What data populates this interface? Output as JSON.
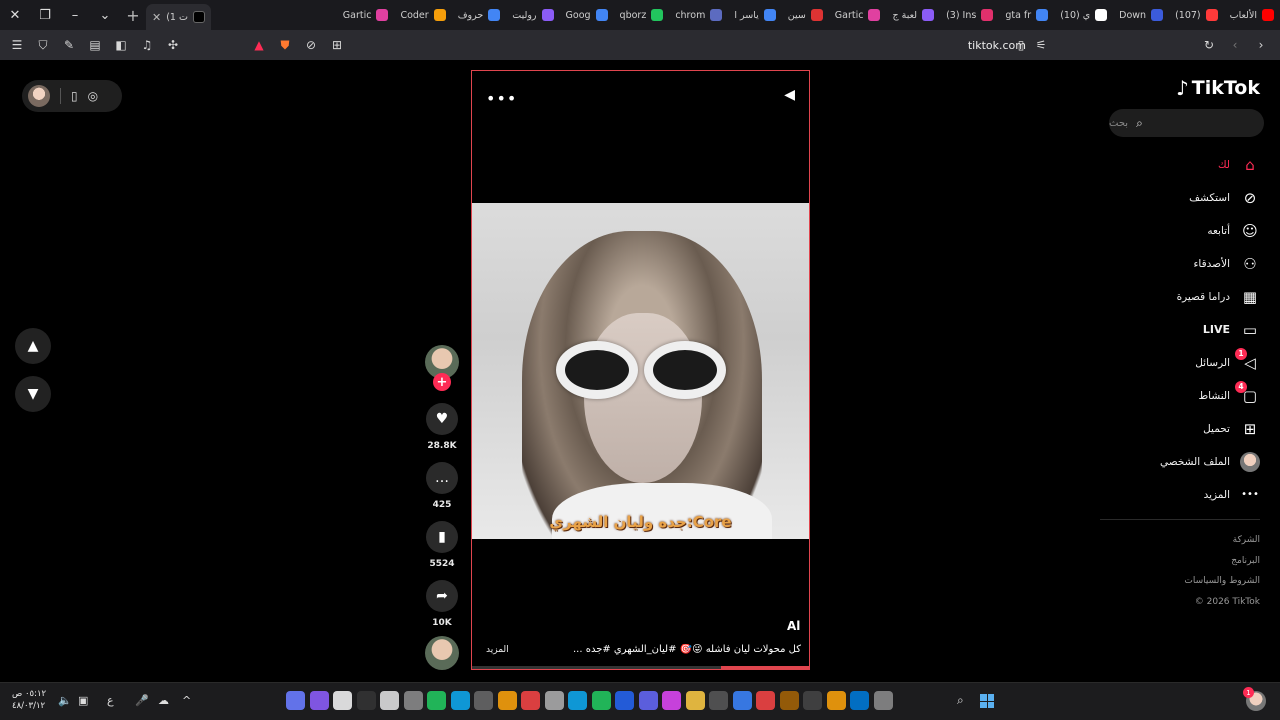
{
  "browser": {
    "tabs": [
      {
        "label": "الألعاب",
        "color": "#ff0000"
      },
      {
        "label": "(107)",
        "color": "#ff3a3a"
      },
      {
        "label": "Down",
        "color": "#3b5bdb"
      },
      {
        "label": "(10) ي",
        "color": "#ffffff"
      },
      {
        "label": "gta fr",
        "color": "#4285f4"
      },
      {
        "label": "(3) Ins",
        "color": "#e1306c"
      },
      {
        "label": "لعبة ج",
        "color": "#8b5cf6"
      },
      {
        "label": "Gartic",
        "color": "#e040a0"
      },
      {
        "label": "سين",
        "color": "#d33"
      },
      {
        "label": "ياسر ا",
        "color": "#4285f4"
      },
      {
        "label": "chrom",
        "color": "#5c6bc0"
      },
      {
        "label": "qborz",
        "color": "#22c55e"
      },
      {
        "label": "Goog",
        "color": "#4285f4"
      },
      {
        "label": "روليت",
        "color": "#8b5cf6"
      },
      {
        "label": "حروف",
        "color": "#4285f4"
      },
      {
        "label": "Coder",
        "color": "#f59e0b"
      },
      {
        "label": "Gartic",
        "color": "#e040a0"
      }
    ],
    "active_tab": {
      "label": "(1 ت",
      "color": "#000000"
    },
    "address": "tiktok.com"
  },
  "page": {
    "nav_up": "▲",
    "nav_down": "▼"
  },
  "video": {
    "overlay_caption": "جده وليان الشهري:Core",
    "author": "Al",
    "description": "كل محولات ليان فاشله 😜🎯 #ليان_الشهري #جده ...",
    "more_label": "المزيد",
    "progress": 0.26
  },
  "actions": {
    "likes": "28.8K",
    "comments": "425",
    "saves": "5524",
    "shares": "10K"
  },
  "sidebar": {
    "logo": "TikTok",
    "search_placeholder": "بحث",
    "items": [
      {
        "label": "لك",
        "icon": "home-icon",
        "active": true
      },
      {
        "label": "استكشف",
        "icon": "compass-icon"
      },
      {
        "label": "أتابعه",
        "icon": "following-icon"
      },
      {
        "label": "الأصدقاء",
        "icon": "friends-icon"
      },
      {
        "label": "دراما قصيرة",
        "icon": "film-icon"
      },
      {
        "label": "LIVE",
        "icon": "live-icon"
      },
      {
        "label": "الرسائل",
        "icon": "messages-icon",
        "badge": "1"
      },
      {
        "label": "النشاط",
        "icon": "activity-icon",
        "badge": "4"
      },
      {
        "label": "تحميل",
        "icon": "upload-icon"
      },
      {
        "label": "الملف الشخصي",
        "icon": "profile-avatar"
      },
      {
        "label": "المزيد",
        "icon": "more-icon"
      }
    ],
    "footer": [
      "الشركة",
      "البرنامج",
      "الشروط والسياسات",
      "© 2026 TikTok"
    ]
  },
  "taskbar": {
    "time": "٠٥:١٢ ص",
    "date": "٤٨/٠٣/١٢",
    "lang": "ع",
    "notification_count": "1"
  }
}
